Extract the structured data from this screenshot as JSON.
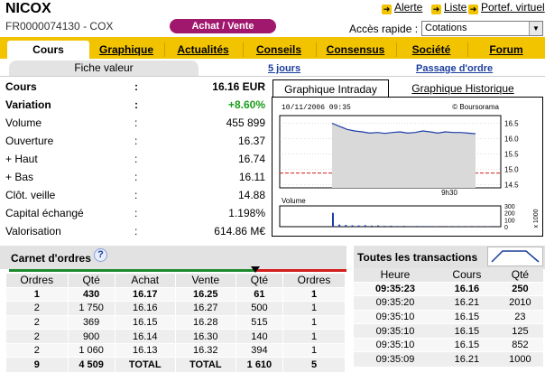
{
  "header": {
    "name": "NICOX",
    "isin": "FR0000074130 - COX",
    "achat_vente": "Achat / Vente",
    "links": [
      "Alerte",
      "Liste",
      "Portef. virtuel"
    ],
    "acces_label": "Accès rapide :",
    "acces_value": "Cotations"
  },
  "nav": {
    "tabs": [
      "Cours",
      "Graphique",
      "Actualités",
      "Conseils",
      "Consensus",
      "Société",
      "Forum"
    ],
    "active": "Cours"
  },
  "subnav": {
    "fiche": "Fiche valeur",
    "jours": "5 jours",
    "ordre": "Passage d'ordre"
  },
  "fiche": [
    {
      "label": "Cours",
      "colon": ":",
      "value": "16.16 EUR",
      "bold": true
    },
    {
      "label": "Variation",
      "colon": ":",
      "value": "+8.60%",
      "bold": true
    },
    {
      "label": "Volume",
      "colon": ":",
      "value": "455 899"
    },
    {
      "label": "Ouverture",
      "colon": ":",
      "value": "16.37"
    },
    {
      "label": "+ Haut",
      "colon": ":",
      "value": "16.74"
    },
    {
      "label": "+ Bas",
      "colon": ":",
      "value": "16.11"
    },
    {
      "label": "Clôt. veille",
      "colon": ":",
      "value": "14.88"
    },
    {
      "label": "Capital échangé",
      "colon": ":",
      "value": "1.198%"
    },
    {
      "label": "Valorisation",
      "colon": ":",
      "value": "614.86 M€"
    }
  ],
  "graph": {
    "tab_intraday": "Graphique Intraday",
    "tab_historique": "Graphique Historique",
    "stamp": "10/11/2006 09:35",
    "source": "© Boursorama",
    "xtick": "9h30",
    "volume_label": "Volume",
    "yticks": [
      "16.5",
      "16.0",
      "15.5",
      "15.0",
      "14.5"
    ],
    "vol_ticks": [
      "300",
      "200",
      "100",
      "0"
    ],
    "vol_unit": "x 1000"
  },
  "chart_data": {
    "type": "line",
    "title": "",
    "series": [
      {
        "values": [
          16.5,
          16.4,
          16.3,
          16.25,
          16.22,
          16.18,
          16.2,
          16.17,
          16.2,
          16.22,
          16.18,
          16.2,
          16.25,
          16.22,
          16.18,
          16.22,
          16.2,
          16.2,
          16.18,
          16.16
        ]
      }
    ],
    "reference_line": 14.88,
    "ylim": [
      14.4,
      16.75
    ],
    "volume": [
      200,
      30,
      25,
      20,
      18,
      22,
      15,
      18,
      12,
      14,
      10,
      12,
      8,
      10,
      9,
      8,
      7,
      9,
      6,
      7,
      5,
      6,
      5,
      4,
      5
    ],
    "volume_ylim": [
      0,
      300
    ]
  },
  "carnet": {
    "title": "Carnet d'ordres",
    "headers": [
      "Ordres",
      "Qté",
      "Achat",
      "Vente",
      "Qté",
      "Ordres"
    ],
    "rows": [
      [
        "1",
        "430",
        "16.17",
        "16.25",
        "61",
        "1"
      ],
      [
        "2",
        "1 750",
        "16.16",
        "16.27",
        "500",
        "1"
      ],
      [
        "2",
        "369",
        "16.15",
        "16.28",
        "515",
        "1"
      ],
      [
        "2",
        "900",
        "16.14",
        "16.30",
        "140",
        "1"
      ],
      [
        "2",
        "1 060",
        "16.13",
        "16.32",
        "394",
        "1"
      ],
      [
        "9",
        "4 509",
        "TOTAL",
        "TOTAL",
        "1 610",
        "5"
      ]
    ]
  },
  "transactions": {
    "title": "Toutes les transactions",
    "headers": [
      "Heure",
      "Cours",
      "Qté"
    ],
    "rows": [
      [
        "09:35:23",
        "16.16",
        "250"
      ],
      [
        "09:35:20",
        "16.21",
        "2010"
      ],
      [
        "09:35:10",
        "16.15",
        "23"
      ],
      [
        "09:35:10",
        "16.15",
        "125"
      ],
      [
        "09:35:10",
        "16.15",
        "852"
      ],
      [
        "09:35:09",
        "16.21",
        "1000"
      ]
    ]
  }
}
